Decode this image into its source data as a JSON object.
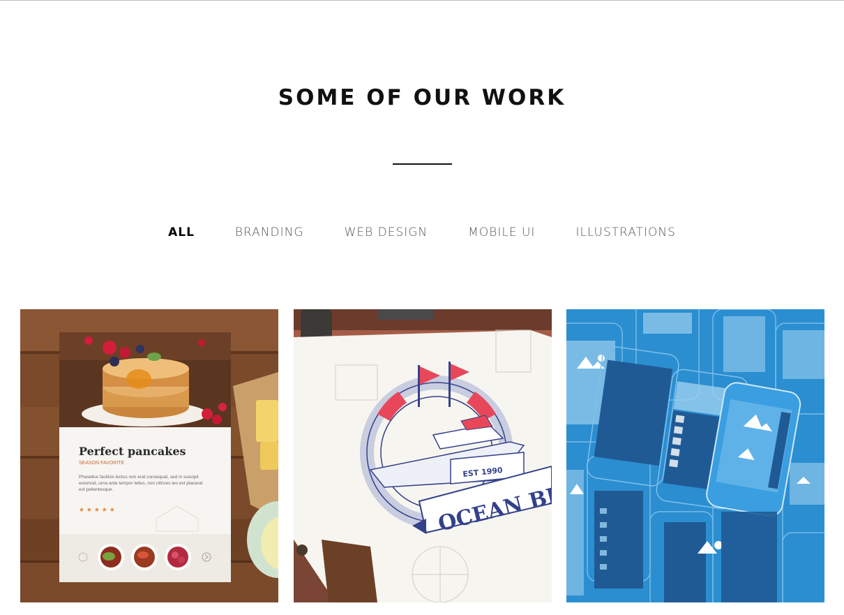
{
  "section": {
    "title": "SOME OF OUR WORK"
  },
  "filters": [
    {
      "label": "ALL",
      "active": true
    },
    {
      "label": "BRANDING",
      "active": false
    },
    {
      "label": "WEB DESIGN",
      "active": false
    },
    {
      "label": "MOBILE UI",
      "active": false
    },
    {
      "label": "ILLUSTRATIONS",
      "active": false
    }
  ],
  "portfolio": {
    "items": [
      {
        "card_title": "Perfect pancakes",
        "card_subtitle": "SEASON FAVORITE",
        "card_text": "Phasellus facilisis lectus non erat consequat, sed in suscipit euismod, urna ante tempor tellus, non ultrices leo est placerat est pellentesque.",
        "rating": 5
      },
      {
        "badge_top": "EST 1990",
        "badge_name": "OCEAN BLUE"
      },
      {
        "category": "mobile-ui"
      }
    ]
  },
  "colors": {
    "accent": "#000000",
    "blueprint": "#2b8ed0"
  }
}
